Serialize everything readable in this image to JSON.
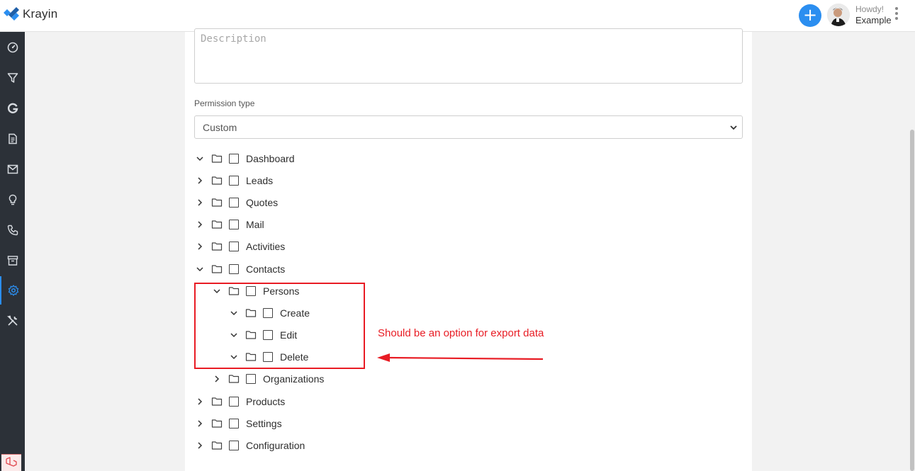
{
  "app": {
    "name": "Krayin"
  },
  "header": {
    "add_button_glyph": "+",
    "greeting": "Howdy!",
    "user": "Example"
  },
  "sidebar": {
    "items": [
      {
        "name": "dashboard-icon"
      },
      {
        "name": "filter-icon"
      },
      {
        "name": "leads-icon"
      },
      {
        "name": "quotes-icon"
      },
      {
        "name": "mail-icon"
      },
      {
        "name": "activities-icon"
      },
      {
        "name": "phone-icon"
      },
      {
        "name": "products-icon"
      },
      {
        "name": "settings-icon",
        "active": true
      },
      {
        "name": "configuration-icon"
      }
    ]
  },
  "form": {
    "description_placeholder": "Description",
    "permission_type_label": "Permission type",
    "permission_type_value": "Custom"
  },
  "tree": [
    {
      "label": "Dashboard",
      "expanded": true,
      "level": 0
    },
    {
      "label": "Leads",
      "expanded": false,
      "level": 0
    },
    {
      "label": "Quotes",
      "expanded": false,
      "level": 0
    },
    {
      "label": "Mail",
      "expanded": false,
      "level": 0
    },
    {
      "label": "Activities",
      "expanded": false,
      "level": 0
    },
    {
      "label": "Contacts",
      "expanded": true,
      "level": 0
    },
    {
      "label": "Persons",
      "expanded": true,
      "level": 1
    },
    {
      "label": "Create",
      "expanded": true,
      "level": 2
    },
    {
      "label": "Edit",
      "expanded": true,
      "level": 2
    },
    {
      "label": "Delete",
      "expanded": true,
      "level": 2
    },
    {
      "label": "Organizations",
      "expanded": false,
      "level": 1
    },
    {
      "label": "Products",
      "expanded": false,
      "level": 0
    },
    {
      "label": "Settings",
      "expanded": false,
      "level": 0
    },
    {
      "label": "Configuration",
      "expanded": false,
      "level": 0
    }
  ],
  "annotation": {
    "text": "Should be an option for export data",
    "color": "#e81c24"
  },
  "colors": {
    "accent": "#2b8ef0",
    "sidebar": "#2c3138"
  }
}
